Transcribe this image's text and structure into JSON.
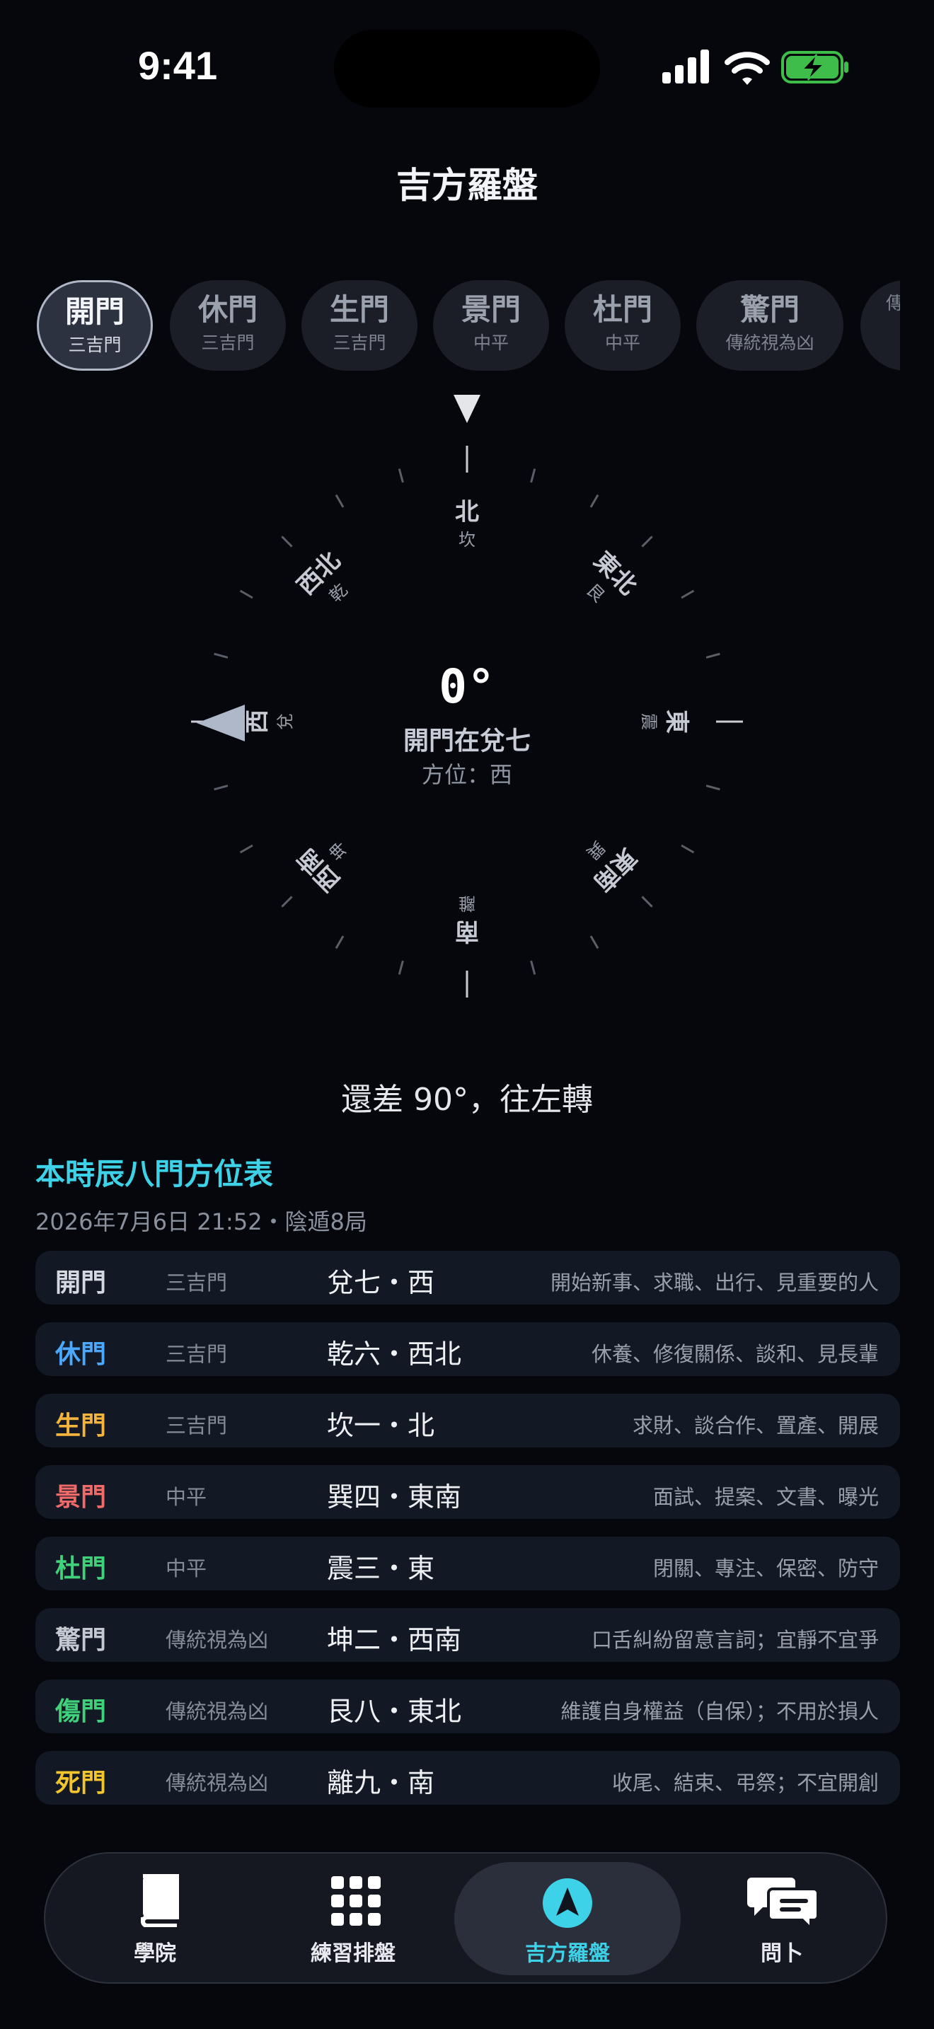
{
  "status_bar": {
    "time": "9:41"
  },
  "page_title": "吉方羅盤",
  "gates": [
    {
      "name": "開門",
      "tag": "三吉門",
      "active": true
    },
    {
      "name": "休門",
      "tag": "三吉門"
    },
    {
      "name": "生門",
      "tag": "三吉門"
    },
    {
      "name": "景門",
      "tag": "中平"
    },
    {
      "name": "杜門",
      "tag": "中平"
    },
    {
      "name": "驚門",
      "tag": "傳統視為凶"
    },
    {
      "name": "",
      "tag": "傳"
    }
  ],
  "compass": {
    "heading": "0°",
    "gate_location": "開門在兌七",
    "direction": "方位：西",
    "directions": [
      {
        "dir": "北",
        "trigram": "坎"
      },
      {
        "dir": "東北",
        "trigram": "艮"
      },
      {
        "dir": "東",
        "trigram": "震"
      },
      {
        "dir": "東南",
        "trigram": "巽"
      },
      {
        "dir": "南",
        "trigram": "離"
      },
      {
        "dir": "西南",
        "trigram": "坤"
      },
      {
        "dir": "西",
        "trigram": "兌"
      },
      {
        "dir": "西北",
        "trigram": "乾"
      }
    ]
  },
  "hint": "還差 90°，往左轉",
  "table": {
    "title": "本時辰八門方位表",
    "meta": "2026年7月6日 21:52・陰遁8局",
    "rows": [
      {
        "gate": "開門",
        "type": "三吉門",
        "position": "兌七・西",
        "note": "開始新事、求職、出行、見重要的人",
        "color": "#d4d8e0"
      },
      {
        "gate": "休門",
        "type": "三吉門",
        "position": "乾六・西北",
        "note": "休養、修復關係、談和、見長輩",
        "color": "#4aa8ff"
      },
      {
        "gate": "生門",
        "type": "三吉門",
        "position": "坎一・北",
        "note": "求財、談合作、置產、開展",
        "color": "#f3b33d"
      },
      {
        "gate": "景門",
        "type": "中平",
        "position": "巽四・東南",
        "note": "面試、提案、文書、曝光",
        "color": "#f06a6a"
      },
      {
        "gate": "杜門",
        "type": "中平",
        "position": "震三・東",
        "note": "閉關、專注、保密、防守",
        "color": "#3fd27a"
      },
      {
        "gate": "驚門",
        "type": "傳統視為凶",
        "position": "坤二・西南",
        "note": "口舌糾紛留意言詞；宜靜不宜爭",
        "color": "#c4c8d0"
      },
      {
        "gate": "傷門",
        "type": "傳統視為凶",
        "position": "艮八・東北",
        "note": "維護自身權益（自保）；不用於損人",
        "color": "#3fd27a"
      },
      {
        "gate": "死門",
        "type": "傳統視為凶",
        "position": "離九・南",
        "note": "收尾、結束、弔祭；不宜開創",
        "color": "#f3c52c"
      }
    ]
  },
  "tabbar": {
    "items": [
      {
        "label": "學院",
        "icon": "book-icon"
      },
      {
        "label": "練習排盤",
        "icon": "grid-icon"
      },
      {
        "label": "吉方羅盤",
        "icon": "navigation-icon",
        "active": true
      },
      {
        "label": "問卜",
        "icon": "chat-bubbles-icon"
      }
    ]
  }
}
